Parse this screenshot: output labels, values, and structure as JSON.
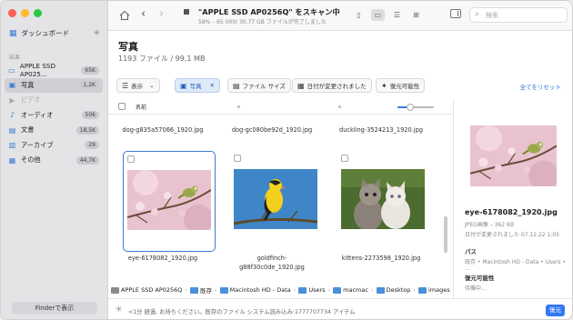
{
  "sidebar": {
    "dashboard_label": "ダッシュボード",
    "section_label": "結果",
    "items": [
      {
        "label": "APPLE SSD AP025...",
        "badge": "65K",
        "icon": "disk-icon"
      },
      {
        "label": "写真",
        "badge": "1,2K",
        "icon": "photo-icon",
        "active": true
      },
      {
        "label": "ビデオ",
        "badge": "",
        "icon": "video-icon",
        "dim": true
      },
      {
        "label": "オーディオ",
        "badge": "506",
        "icon": "music-icon"
      },
      {
        "label": "文書",
        "badge": "18,5K",
        "icon": "document-icon"
      },
      {
        "label": "アーカイブ",
        "badge": "29",
        "icon": "archive-icon"
      },
      {
        "label": "その他",
        "badge": "44,7K",
        "icon": "other-icon"
      }
    ],
    "finder_button": "Finderで表示"
  },
  "toolbar": {
    "title": "\"APPLE SSD AP0256Q\" をスキャン中",
    "subtitle": "58% – 65 000/ 30,77 GB ファイルが完了しました",
    "search_placeholder": "検索"
  },
  "header": {
    "title": "写真",
    "subtitle": "1193 ファイル / 99,1 MB"
  },
  "filters": {
    "view_label": "表示",
    "photo_label": "写真",
    "filesize_label": "ファイル サイズ",
    "date_label": "日付が変更されました",
    "recoverability_label": "復元可能性",
    "reset_label": "全てをリセット"
  },
  "columns": {
    "name_label": "名前",
    "thumb_size": 0.35
  },
  "grid": {
    "top_row": [
      "dog-g835a57066_1920.jpg",
      "dog-gc080be92d_1920.jpg",
      "duckling-3524213_1920.jpg"
    ],
    "tiles": [
      {
        "name": "eye-6178082_1920.jpg",
        "name2": "",
        "selected": true
      },
      {
        "name": "goldfinch-",
        "name2": "g88f30c0de_1920.jpg",
        "selected": false
      },
      {
        "name": "kittens-2273598_1920.jpg",
        "name2": "",
        "selected": false
      }
    ]
  },
  "preview": {
    "name": "eye-6178082_1920.jpg",
    "meta": "JPEG画像 – 362 KB",
    "date": "日付が変更されました 07.12.22 1:05",
    "path_heading": "パス",
    "path_value": "既存 • Macintosh HD - Data • Users • ...",
    "recover_heading": "復元可能性",
    "recover_value": "待機中..."
  },
  "pathbar": [
    "APPLE SSD AP0256Q",
    "既存",
    "Macintosh HD - Data",
    "Users",
    "macmac",
    "Desktop",
    "images"
  ],
  "status": {
    "text": "<1分 経過, お待ちください。既存のファイル システム読み込み:1777707734 アイテム",
    "recover_button": "復元"
  },
  "colors": {
    "accent": "#3478f6",
    "selection": "#3a7bd5"
  }
}
